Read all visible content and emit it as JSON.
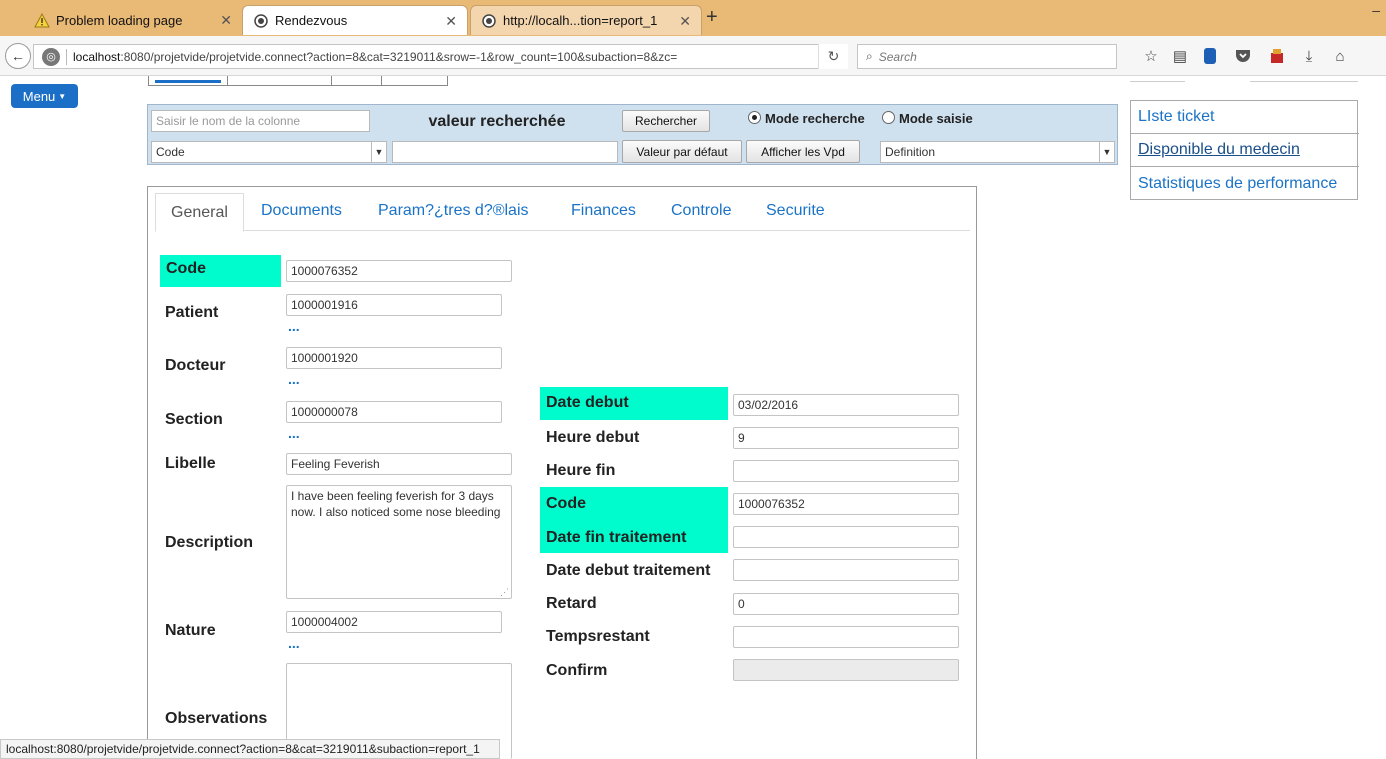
{
  "browser": {
    "tabs": [
      {
        "icon": "warning-icon",
        "title": "Problem loading page"
      },
      {
        "icon": "page-icon",
        "title": "Rendezvous"
      },
      {
        "icon": "page-icon",
        "title": "http://localh...tion=report_1"
      }
    ],
    "url_host": "localhost",
    "url_path": ":8080/projetvide/projetvide.connect?action=8&cat=3219011&srow=-1&row_count=100&subaction=8&zc=",
    "search_placeholder": "Search",
    "status_url": "localhost:8080/projetvide/projetvide.connect?action=8&cat=3219011&subaction=report_1"
  },
  "menu": {
    "label": "Menu"
  },
  "search_panel": {
    "column_placeholder": "Saisir le nom de la colonne",
    "header": "valeur recherchée",
    "search_button": "Rechercher",
    "mode_search": "Mode recherche",
    "mode_entry": "Mode saisie",
    "column_select": "Code",
    "search_value": "",
    "default_button": "Valeur par défaut",
    "show_vpd_button": "Afficher les Vpd",
    "definition_select": "Definition"
  },
  "side_links": [
    "LIste ticket",
    "Disponible du medecin",
    "Statistiques de performance"
  ],
  "form_tabs": [
    "General",
    "Documents",
    "Param?¿tres d?®lais",
    "Finances",
    "Controle",
    "Securite"
  ],
  "left_form": {
    "code": {
      "label": "Code",
      "value": "1000076352"
    },
    "patient": {
      "label": "Patient",
      "value": "1000001916",
      "more": "..."
    },
    "docteur": {
      "label": "Docteur",
      "value": "1000001920",
      "more": "..."
    },
    "section": {
      "label": "Section",
      "value": "1000000078",
      "more": "..."
    },
    "libelle": {
      "label": "Libelle",
      "value": "Feeling Feverish"
    },
    "description": {
      "label": "Description",
      "value": "I have been feeling feverish for 3 days now. I also noticed some nose bleeding"
    },
    "nature": {
      "label": "Nature",
      "value": "1000004002",
      "more": "..."
    },
    "observations": {
      "label": "Observations",
      "value": ""
    }
  },
  "right_form": {
    "date_debut": {
      "label": "Date debut",
      "value": "03/02/2016"
    },
    "heure_debut": {
      "label": "Heure debut",
      "value": "9"
    },
    "heure_fin": {
      "label": "Heure fin",
      "value": ""
    },
    "code": {
      "label": "Code",
      "value": "1000076352"
    },
    "date_fin_traitement": {
      "label": "Date fin traitement",
      "value": ""
    },
    "date_debut_traitement": {
      "label": "Date debut traitement",
      "value": ""
    },
    "retard": {
      "label": "Retard",
      "value": "0"
    },
    "tempsrestant": {
      "label": "Tempsrestant",
      "value": ""
    },
    "confirm": {
      "label": "Confirm",
      "value": ""
    }
  },
  "colors": {
    "highlight": "#00fccc",
    "link": "#1a73c6",
    "menu_button": "#1c6fc7",
    "tab_bar": "#e9b976",
    "search_panel_bg": "#cfe0ef"
  }
}
